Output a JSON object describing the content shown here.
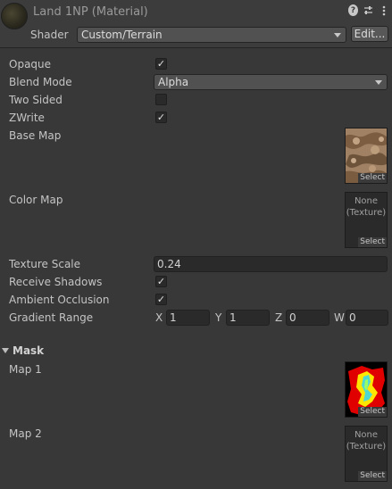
{
  "header": {
    "title": "Land 1NP (Material)",
    "shader_label": "Shader",
    "shader_value": "Custom/Terrain",
    "edit_label": "Edit...",
    "icons": [
      "help-icon",
      "preset-icon",
      "more-icon"
    ]
  },
  "properties": {
    "opaque": {
      "label": "Opaque",
      "checked": true
    },
    "blend_mode": {
      "label": "Blend Mode",
      "value": "Alpha"
    },
    "two_sided": {
      "label": "Two Sided",
      "checked": false
    },
    "zwrite": {
      "label": "ZWrite",
      "checked": true
    },
    "base_map": {
      "label": "Base Map",
      "select": "Select"
    },
    "color_map": {
      "label": "Color Map",
      "none_line1": "None",
      "none_line2": "(Texture)",
      "select": "Select"
    },
    "texture_scale": {
      "label": "Texture Scale",
      "value": "0.24"
    },
    "receive_shadows": {
      "label": "Receive Shadows",
      "checked": true
    },
    "ambient_occlusion": {
      "label": "Ambient Occlusion",
      "checked": true
    },
    "gradient_range": {
      "label": "Gradient Range",
      "x_label": "X",
      "x": "1",
      "y_label": "Y",
      "y": "1",
      "z_label": "Z",
      "z": "0",
      "w_label": "W",
      "w": "0"
    }
  },
  "mask": {
    "title": "Mask",
    "map1": {
      "label": "Map 1",
      "select": "Select"
    },
    "map2": {
      "label": "Map 2",
      "none_line1": "None",
      "none_line2": "(Texture)",
      "select": "Select"
    }
  },
  "check_glyph": "✓"
}
